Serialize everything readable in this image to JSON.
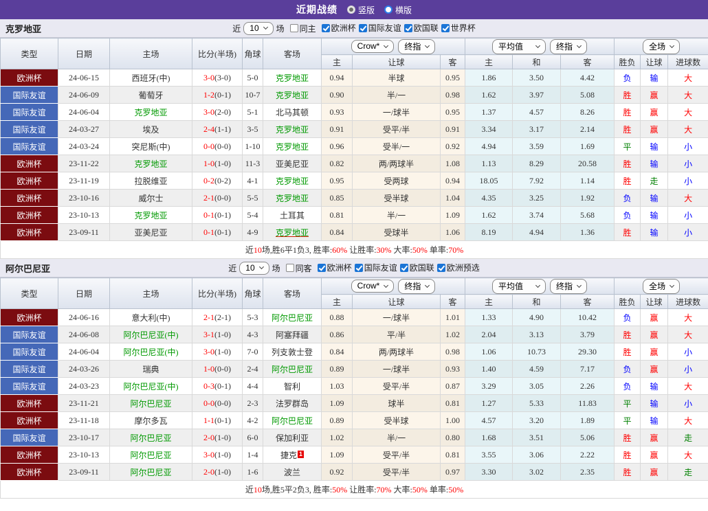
{
  "header": {
    "title": "近期战绩",
    "modes": [
      "竖版",
      "横版"
    ],
    "selected_mode": "竖版"
  },
  "filters": {
    "near": "近",
    "count": "10",
    "games": "场"
  },
  "table_header": {
    "type": "类型",
    "date": "日期",
    "home": "主场",
    "score": "比分(半场)",
    "corner": "角球",
    "away": "客场",
    "company_select": "Crow*",
    "final_select": "终指",
    "avg_select": "平均值",
    "final_select2": "终指",
    "scope_select": "全场",
    "sub": {
      "home": "主",
      "handicap": "让球",
      "away": "客",
      "avg_home": "主",
      "avg_draw": "和",
      "avg_away": "客",
      "result": "胜负",
      "handicap_result": "让球",
      "goals": "进球数"
    }
  },
  "colors": {
    "topbar_purple": "#5a3e9b",
    "euro_badge": "#7b0c10",
    "friendly_badge": "#4568b8",
    "team_highlight_green": "#009900",
    "win_red": "#ff0000",
    "lose_blue": "#0000ff",
    "draw_green": "#008000",
    "company_col_bg": "#fcf5ea",
    "avg_col_bg": "#e9f6f9"
  },
  "sections": [
    {
      "team": "克罗地亚",
      "same": {
        "label": "同主",
        "checked": false
      },
      "leagues": [
        {
          "label": "欧洲杯",
          "checked": true
        },
        {
          "label": "国际友谊",
          "checked": true
        },
        {
          "label": "欧国联",
          "checked": true
        },
        {
          "label": "世界杯",
          "checked": true
        }
      ],
      "rows": [
        {
          "lg": {
            "t": "欧洲杯",
            "c": "euro"
          },
          "date": "24-06-15",
          "home": {
            "t": "西班牙(中)",
            "c": ""
          },
          "score": "3-0",
          "half": "(3-0)",
          "corner": "5-0",
          "away": {
            "t": "克罗地亚",
            "c": "green",
            "badge": ""
          },
          "odds": [
            "0.94",
            "半球",
            "0.95",
            "1.86",
            "3.50",
            "4.42"
          ],
          "res": {
            "t": "负",
            "c": "blue"
          },
          "hcp": {
            "t": "输",
            "c": "blue"
          },
          "goal": {
            "t": "大",
            "c": "red"
          }
        },
        {
          "lg": {
            "t": "国际友谊",
            "c": "fr"
          },
          "date": "24-06-09",
          "home": {
            "t": "葡萄牙",
            "c": ""
          },
          "score": "1-2",
          "half": "(0-1)",
          "corner": "10-7",
          "away": {
            "t": "克罗地亚",
            "c": "green",
            "badge": ""
          },
          "odds": [
            "0.90",
            "半/一",
            "0.98",
            "1.62",
            "3.97",
            "5.08"
          ],
          "res": {
            "t": "胜",
            "c": "red"
          },
          "hcp": {
            "t": "赢",
            "c": "red"
          },
          "goal": {
            "t": "大",
            "c": "red"
          }
        },
        {
          "lg": {
            "t": "国际友谊",
            "c": "fr"
          },
          "date": "24-06-04",
          "home": {
            "t": "克罗地亚",
            "c": "green"
          },
          "score": "3-0",
          "half": "(2-0)",
          "corner": "5-1",
          "away": {
            "t": "北马其顿",
            "c": "",
            "badge": ""
          },
          "odds": [
            "0.93",
            "一/球半",
            "0.95",
            "1.37",
            "4.57",
            "8.26"
          ],
          "res": {
            "t": "胜",
            "c": "red"
          },
          "hcp": {
            "t": "赢",
            "c": "red"
          },
          "goal": {
            "t": "大",
            "c": "red"
          }
        },
        {
          "lg": {
            "t": "国际友谊",
            "c": "fr"
          },
          "date": "24-03-27",
          "home": {
            "t": "埃及",
            "c": ""
          },
          "score": "2-4",
          "half": "(1-1)",
          "corner": "3-5",
          "away": {
            "t": "克罗地亚",
            "c": "green",
            "badge": ""
          },
          "odds": [
            "0.91",
            "受平/半",
            "0.91",
            "3.34",
            "3.17",
            "2.14"
          ],
          "res": {
            "t": "胜",
            "c": "red"
          },
          "hcp": {
            "t": "赢",
            "c": "red"
          },
          "goal": {
            "t": "大",
            "c": "red"
          }
        },
        {
          "lg": {
            "t": "国际友谊",
            "c": "fr"
          },
          "date": "24-03-24",
          "home": {
            "t": "突尼斯(中)",
            "c": ""
          },
          "score": "0-0",
          "half": "(0-0)",
          "corner": "1-10",
          "away": {
            "t": "克罗地亚",
            "c": "green",
            "badge": ""
          },
          "odds": [
            "0.96",
            "受半/一",
            "0.92",
            "4.94",
            "3.59",
            "1.69"
          ],
          "res": {
            "t": "平",
            "c": "dgreen"
          },
          "hcp": {
            "t": "输",
            "c": "blue"
          },
          "goal": {
            "t": "小",
            "c": "blue"
          }
        },
        {
          "lg": {
            "t": "欧洲杯",
            "c": "euro"
          },
          "date": "23-11-22",
          "home": {
            "t": "克罗地亚",
            "c": "green"
          },
          "score": "1-0",
          "half": "(1-0)",
          "corner": "11-3",
          "away": {
            "t": "亚美尼亚",
            "c": "",
            "badge": ""
          },
          "odds": [
            "0.82",
            "两/两球半",
            "1.08",
            "1.13",
            "8.29",
            "20.58"
          ],
          "res": {
            "t": "胜",
            "c": "red"
          },
          "hcp": {
            "t": "输",
            "c": "blue"
          },
          "goal": {
            "t": "小",
            "c": "blue"
          }
        },
        {
          "lg": {
            "t": "欧洲杯",
            "c": "euro"
          },
          "date": "23-11-19",
          "home": {
            "t": "拉脱维亚",
            "c": ""
          },
          "score": "0-2",
          "half": "(0-2)",
          "corner": "4-1",
          "away": {
            "t": "克罗地亚",
            "c": "green",
            "badge": ""
          },
          "odds": [
            "0.95",
            "受两球",
            "0.94",
            "18.05",
            "7.92",
            "1.14"
          ],
          "res": {
            "t": "胜",
            "c": "red"
          },
          "hcp": {
            "t": "走",
            "c": "dgreen"
          },
          "goal": {
            "t": "小",
            "c": "blue"
          }
        },
        {
          "lg": {
            "t": "欧洲杯",
            "c": "euro"
          },
          "date": "23-10-16",
          "home": {
            "t": "威尔士",
            "c": ""
          },
          "score": "2-1",
          "half": "(0-0)",
          "corner": "5-5",
          "away": {
            "t": "克罗地亚",
            "c": "green",
            "badge": ""
          },
          "odds": [
            "0.85",
            "受半球",
            "1.04",
            "4.35",
            "3.25",
            "1.92"
          ],
          "res": {
            "t": "负",
            "c": "blue"
          },
          "hcp": {
            "t": "输",
            "c": "blue"
          },
          "goal": {
            "t": "大",
            "c": "red"
          }
        },
        {
          "lg": {
            "t": "欧洲杯",
            "c": "euro"
          },
          "date": "23-10-13",
          "home": {
            "t": "克罗地亚",
            "c": "green"
          },
          "score": "0-1",
          "half": "(0-1)",
          "corner": "5-4",
          "away": {
            "t": "土耳其",
            "c": "",
            "badge": ""
          },
          "odds": [
            "0.81",
            "半/一",
            "1.09",
            "1.62",
            "3.74",
            "5.68"
          ],
          "res": {
            "t": "负",
            "c": "blue"
          },
          "hcp": {
            "t": "输",
            "c": "blue"
          },
          "goal": {
            "t": "小",
            "c": "blue"
          }
        },
        {
          "lg": {
            "t": "欧洲杯",
            "c": "euro"
          },
          "date": "23-09-11",
          "home": {
            "t": "亚美尼亚",
            "c": ""
          },
          "score": "0-1",
          "half": "(0-1)",
          "corner": "4-9",
          "away": {
            "t": "克罗地亚",
            "c": "green-u",
            "badge": ""
          },
          "odds": [
            "0.84",
            "受球半",
            "1.06",
            "8.19",
            "4.94",
            "1.36"
          ],
          "res": {
            "t": "胜",
            "c": "red"
          },
          "hcp": {
            "t": "输",
            "c": "blue"
          },
          "goal": {
            "t": "小",
            "c": "blue"
          }
        }
      ],
      "summary": [
        [
          "近",
          "k"
        ],
        [
          "10",
          "r"
        ],
        [
          "场,胜6平1负3, 胜率:",
          "k"
        ],
        [
          "60%",
          "r"
        ],
        [
          " 让胜率:",
          "k"
        ],
        [
          "30%",
          "r"
        ],
        [
          " 大率:",
          "k"
        ],
        [
          "50%",
          "r"
        ],
        [
          " 单率:",
          "k"
        ],
        [
          "70%",
          "r"
        ]
      ]
    },
    {
      "team": "阿尔巴尼亚",
      "same": {
        "label": "同客",
        "checked": false
      },
      "leagues": [
        {
          "label": "欧洲杯",
          "checked": true
        },
        {
          "label": "国际友谊",
          "checked": true
        },
        {
          "label": "欧国联",
          "checked": true
        },
        {
          "label": "欧洲预选",
          "checked": true
        }
      ],
      "rows": [
        {
          "lg": {
            "t": "欧洲杯",
            "c": "euro"
          },
          "date": "24-06-16",
          "home": {
            "t": "意大利(中)",
            "c": ""
          },
          "score": "2-1",
          "half": "(2-1)",
          "corner": "5-3",
          "away": {
            "t": "阿尔巴尼亚",
            "c": "green",
            "badge": ""
          },
          "odds": [
            "0.88",
            "一/球半",
            "1.01",
            "1.33",
            "4.90",
            "10.42"
          ],
          "res": {
            "t": "负",
            "c": "blue"
          },
          "hcp": {
            "t": "赢",
            "c": "red"
          },
          "goal": {
            "t": "大",
            "c": "red"
          }
        },
        {
          "lg": {
            "t": "国际友谊",
            "c": "fr"
          },
          "date": "24-06-08",
          "home": {
            "t": "阿尔巴尼亚(中)",
            "c": "green"
          },
          "score": "3-1",
          "half": "(1-0)",
          "corner": "4-3",
          "away": {
            "t": "阿塞拜疆",
            "c": "",
            "badge": ""
          },
          "odds": [
            "0.86",
            "平/半",
            "1.02",
            "2.04",
            "3.13",
            "3.79"
          ],
          "res": {
            "t": "胜",
            "c": "red"
          },
          "hcp": {
            "t": "赢",
            "c": "red"
          },
          "goal": {
            "t": "大",
            "c": "red"
          }
        },
        {
          "lg": {
            "t": "国际友谊",
            "c": "fr"
          },
          "date": "24-06-04",
          "home": {
            "t": "阿尔巴尼亚(中)",
            "c": "green"
          },
          "score": "3-0",
          "half": "(1-0)",
          "corner": "7-0",
          "away": {
            "t": "列支敦士登",
            "c": "",
            "badge": ""
          },
          "odds": [
            "0.84",
            "两/两球半",
            "0.98",
            "1.06",
            "10.73",
            "29.30"
          ],
          "res": {
            "t": "胜",
            "c": "red"
          },
          "hcp": {
            "t": "赢",
            "c": "red"
          },
          "goal": {
            "t": "小",
            "c": "blue"
          }
        },
        {
          "lg": {
            "t": "国际友谊",
            "c": "fr"
          },
          "date": "24-03-26",
          "home": {
            "t": "瑞典",
            "c": ""
          },
          "score": "1-0",
          "half": "(0-0)",
          "corner": "2-4",
          "away": {
            "t": "阿尔巴尼亚",
            "c": "green",
            "badge": ""
          },
          "odds": [
            "0.89",
            "一/球半",
            "0.93",
            "1.40",
            "4.59",
            "7.17"
          ],
          "res": {
            "t": "负",
            "c": "blue"
          },
          "hcp": {
            "t": "赢",
            "c": "red"
          },
          "goal": {
            "t": "小",
            "c": "blue"
          }
        },
        {
          "lg": {
            "t": "国际友谊",
            "c": "fr"
          },
          "date": "24-03-23",
          "home": {
            "t": "阿尔巴尼亚(中)",
            "c": "green"
          },
          "score": "0-3",
          "half": "(0-1)",
          "corner": "4-4",
          "away": {
            "t": "智利",
            "c": "",
            "badge": ""
          },
          "odds": [
            "1.03",
            "受平/半",
            "0.87",
            "3.29",
            "3.05",
            "2.26"
          ],
          "res": {
            "t": "负",
            "c": "blue"
          },
          "hcp": {
            "t": "输",
            "c": "blue"
          },
          "goal": {
            "t": "大",
            "c": "red"
          }
        },
        {
          "lg": {
            "t": "欧洲杯",
            "c": "euro"
          },
          "date": "23-11-21",
          "home": {
            "t": "阿尔巴尼亚",
            "c": "green"
          },
          "score": "0-0",
          "half": "(0-0)",
          "corner": "2-3",
          "away": {
            "t": "法罗群岛",
            "c": "",
            "badge": ""
          },
          "odds": [
            "1.09",
            "球半",
            "0.81",
            "1.27",
            "5.33",
            "11.83"
          ],
          "res": {
            "t": "平",
            "c": "dgreen"
          },
          "hcp": {
            "t": "输",
            "c": "blue"
          },
          "goal": {
            "t": "小",
            "c": "blue"
          }
        },
        {
          "lg": {
            "t": "欧洲杯",
            "c": "euro"
          },
          "date": "23-11-18",
          "home": {
            "t": "摩尔多瓦",
            "c": ""
          },
          "score": "1-1",
          "half": "(0-1)",
          "corner": "4-2",
          "away": {
            "t": "阿尔巴尼亚",
            "c": "green",
            "badge": ""
          },
          "odds": [
            "0.89",
            "受半球",
            "1.00",
            "4.57",
            "3.20",
            "1.89"
          ],
          "res": {
            "t": "平",
            "c": "dgreen"
          },
          "hcp": {
            "t": "输",
            "c": "blue"
          },
          "goal": {
            "t": "大",
            "c": "red"
          }
        },
        {
          "lg": {
            "t": "国际友谊",
            "c": "fr"
          },
          "date": "23-10-17",
          "home": {
            "t": "阿尔巴尼亚",
            "c": "green"
          },
          "score": "2-0",
          "half": "(1-0)",
          "corner": "6-0",
          "away": {
            "t": "保加利亚",
            "c": "",
            "badge": ""
          },
          "odds": [
            "1.02",
            "半/一",
            "0.80",
            "1.68",
            "3.51",
            "5.06"
          ],
          "res": {
            "t": "胜",
            "c": "red"
          },
          "hcp": {
            "t": "赢",
            "c": "red"
          },
          "goal": {
            "t": "走",
            "c": "dgreen"
          }
        },
        {
          "lg": {
            "t": "欧洲杯",
            "c": "euro"
          },
          "date": "23-10-13",
          "home": {
            "t": "阿尔巴尼亚",
            "c": "green"
          },
          "score": "3-0",
          "half": "(1-0)",
          "corner": "1-4",
          "away": {
            "t": "捷克",
            "c": "",
            "badge": "1"
          },
          "odds": [
            "1.09",
            "受平/半",
            "0.81",
            "3.55",
            "3.06",
            "2.22"
          ],
          "res": {
            "t": "胜",
            "c": "red"
          },
          "hcp": {
            "t": "赢",
            "c": "red"
          },
          "goal": {
            "t": "大",
            "c": "red"
          }
        },
        {
          "lg": {
            "t": "欧洲杯",
            "c": "euro"
          },
          "date": "23-09-11",
          "home": {
            "t": "阿尔巴尼亚",
            "c": "green"
          },
          "score": "2-0",
          "half": "(1-0)",
          "corner": "1-6",
          "away": {
            "t": "波兰",
            "c": "",
            "badge": ""
          },
          "odds": [
            "0.92",
            "受平/半",
            "0.97",
            "3.30",
            "3.02",
            "2.35"
          ],
          "res": {
            "t": "胜",
            "c": "red"
          },
          "hcp": {
            "t": "赢",
            "c": "red"
          },
          "goal": {
            "t": "走",
            "c": "dgreen"
          }
        }
      ],
      "summary": [
        [
          "近",
          "k"
        ],
        [
          "10",
          "r"
        ],
        [
          "场,胜5平2负3, 胜率:",
          "k"
        ],
        [
          "50%",
          "r"
        ],
        [
          " 让胜率:",
          "k"
        ],
        [
          "70%",
          "r"
        ],
        [
          " 大率:",
          "k"
        ],
        [
          "50%",
          "r"
        ],
        [
          " 单率:",
          "k"
        ],
        [
          "50%",
          "r"
        ]
      ]
    }
  ]
}
